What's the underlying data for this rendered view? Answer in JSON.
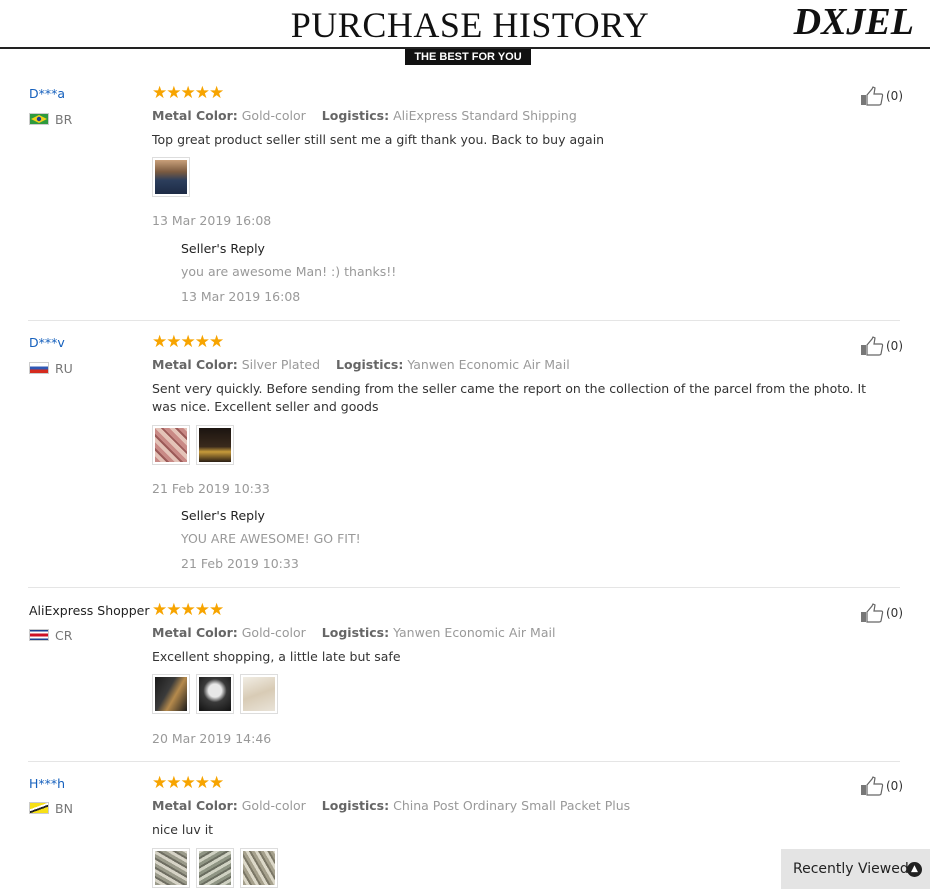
{
  "header": {
    "title": "PURCHASE HISTORY",
    "brand": "DXJEL",
    "badge": "THE BEST FOR YOU"
  },
  "labels": {
    "metal_color": "Metal Color:",
    "logistics": "Logistics:",
    "sellers_reply": "Seller's Reply"
  },
  "reviews": [
    {
      "user": "D***a",
      "country": "BR",
      "stars": "★★★★★",
      "metal_color": "Gold-color",
      "logistics": "AliExpress Standard Shipping",
      "text": "Top great product seller still sent me a gift thank you. Back to buy again",
      "date": "13 Mar 2019 16:08",
      "reply_text": "you are awesome Man! :) thanks!!",
      "reply_date": "13 Mar 2019 16:08",
      "helpful": "(0)"
    },
    {
      "user": "D***v",
      "country": "RU",
      "stars": "★★★★★",
      "metal_color": "Silver Plated",
      "logistics": "Yanwen Economic Air Mail",
      "text": "Sent very quickly. Before sending from the seller came the report on the collection of the parcel from the photo. It was nice. Excellent seller and goods",
      "date": "21 Feb 2019 10:33",
      "reply_text": "YOU ARE AWESOME! GO FIT!",
      "reply_date": "21 Feb 2019 10:33",
      "helpful": "(0)"
    },
    {
      "user": "AliExpress Shopper",
      "country": "CR",
      "stars": "★★★★★",
      "metal_color": "Gold-color",
      "logistics": "Yanwen Economic Air Mail",
      "text": "Excellent shopping, a little late but safe",
      "date": "20 Mar 2019 14:46",
      "helpful": "(0)"
    },
    {
      "user": "H***h",
      "country": "BN",
      "stars": "★★★★★",
      "metal_color": "Gold-color",
      "logistics": "China Post Ordinary Small Packet Plus",
      "text": "nice luv it",
      "helpful": "(0)"
    }
  ],
  "recently_viewed": "Recently Viewed"
}
